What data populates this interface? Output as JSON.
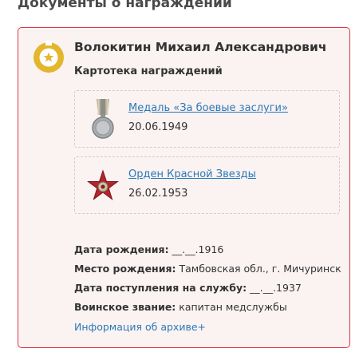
{
  "section": {
    "title": "Документы о награждении"
  },
  "person": {
    "name": "Волокитин Михаил Александрович",
    "card_title": "Картотека награждений",
    "badge_icon": "star-medal-badge-icon"
  },
  "awards": [
    {
      "name": "Медаль «За боевые заслуги»",
      "date": "20.06.1949",
      "icon": "medal-icon"
    },
    {
      "name": "Орден Красной Звезды",
      "date": "26.02.1953",
      "icon": "red-star-order-icon"
    }
  ],
  "info": {
    "birth_date_label": "Дата рождения:",
    "birth_date_value": "__.__.1916",
    "birth_place_label": "Место рождения:",
    "birth_place_value": "Тамбовская обл., г. Мичуринск",
    "service_start_label": "Дата поступления на службу:",
    "service_start_value": "__.__.1937",
    "rank_label": "Воинское звание:",
    "rank_value": "капитан медслужбы"
  },
  "archive_link": "Информация об архиве+",
  "colors": {
    "accent_border": "#d9374b",
    "card_bg": "#fbf2f2",
    "link": "#2a7ab8",
    "badge": "#e3b62c"
  }
}
